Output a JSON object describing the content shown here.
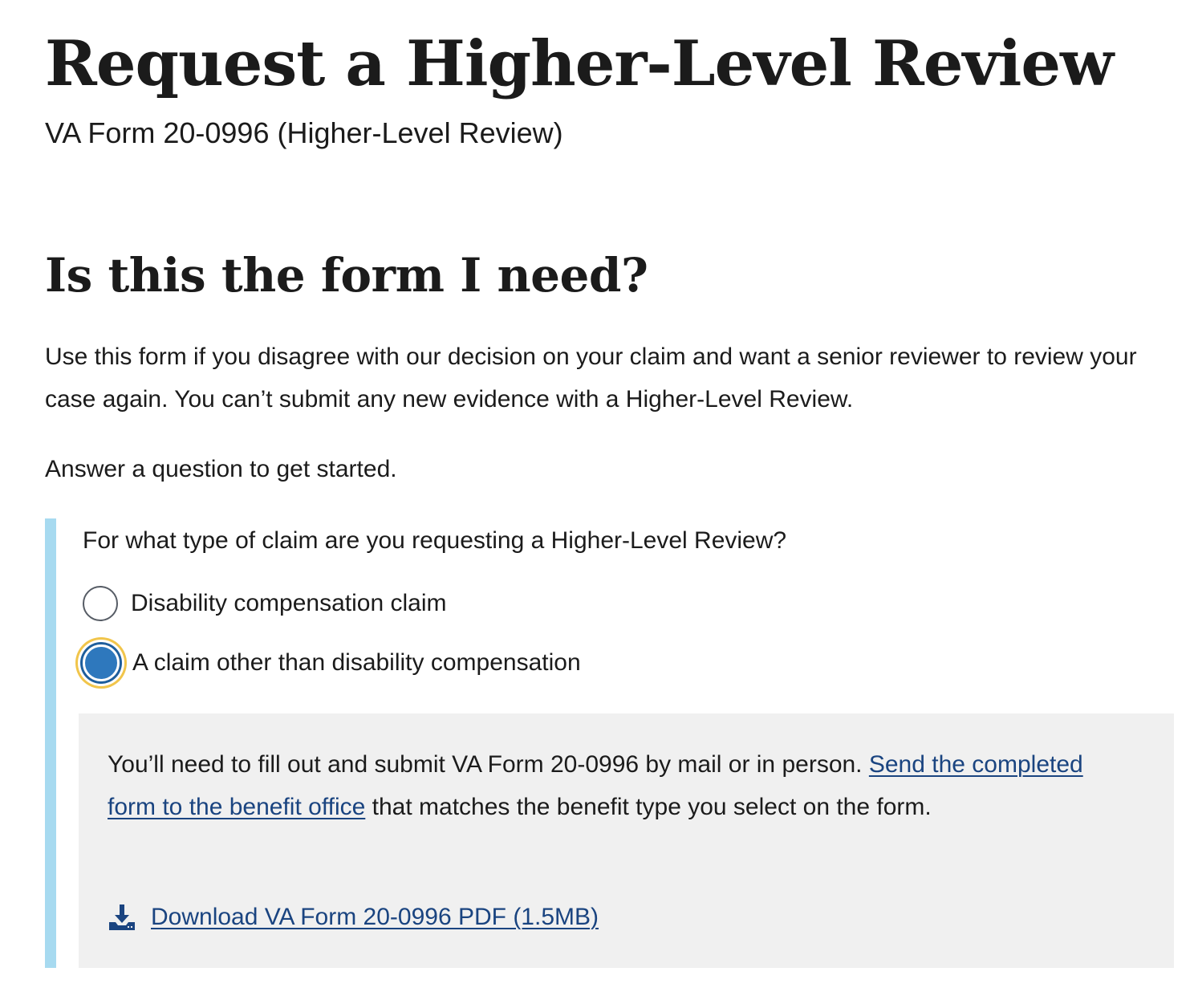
{
  "page": {
    "title": "Request a Higher-Level Review",
    "subtitle": "VA Form 20-0996 (Higher-Level Review)"
  },
  "section": {
    "heading": "Is this the form I need?",
    "intro": "Use this form if you disagree with our decision on your claim and want a senior reviewer to review your case again. You can’t submit any new evidence with a Higher-Level Review.",
    "prompt": "Answer a question to get started."
  },
  "question": {
    "legend": "For what type of claim are you requesting a Higher-Level Review?",
    "options": [
      {
        "label": "Disability compensation claim",
        "checked": false
      },
      {
        "label": "A claim other than disability compensation",
        "checked": true
      }
    ]
  },
  "info": {
    "text_before_link": "You’ll need to fill out and submit VA Form 20-0996 by mail or in person. ",
    "link_text": "Send the completed form to the benefit office",
    "text_after_link": " that matches the benefit type you select on the form.",
    "download_label": "Download VA Form 20-0996 PDF (1.5MB)",
    "download_icon": "download-icon"
  },
  "colors": {
    "accent_bar": "#a7daf0",
    "radio_selected": "#2e78bd",
    "focus_ring": "#f1c54b",
    "link": "#1a4480",
    "panel_bg": "#f0f0f0"
  }
}
